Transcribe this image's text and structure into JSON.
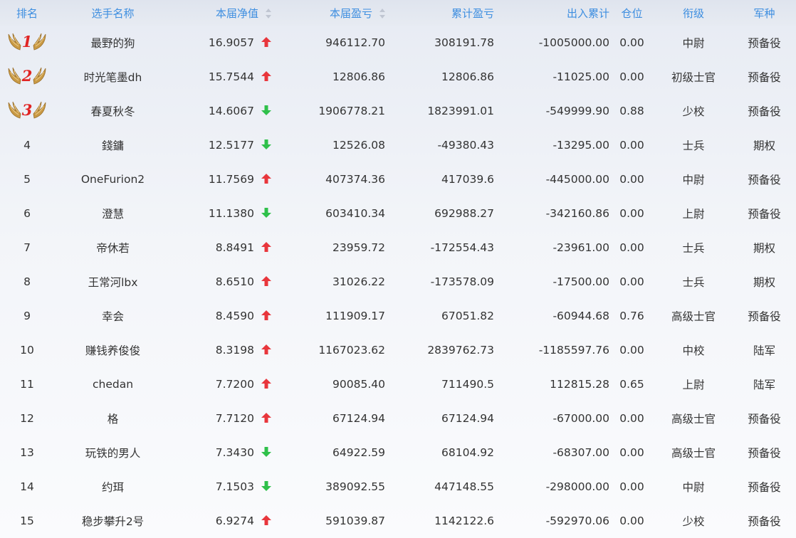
{
  "header": {
    "rank": "排名",
    "name": "选手名称",
    "nav": "本届净值",
    "pnl": "本届盈亏",
    "cum_pnl": "累计盈亏",
    "flow": "出入累计",
    "position": "仓位",
    "title": "衔级",
    "branch": "军种"
  },
  "colors": {
    "header_text": "#3d8ee0",
    "up": "#e8363c",
    "down": "#2fc04a",
    "medal_num": "#e02424",
    "wing": "#c99a45"
  },
  "rows": [
    {
      "rank": "1",
      "name": "最野的狗",
      "nav": "16.9057",
      "trend": "up",
      "pnl": "946112.70",
      "cum_pnl": "308191.78",
      "flow": "-1005000.00",
      "position": "0.00",
      "title": "中尉",
      "branch": "预备役"
    },
    {
      "rank": "2",
      "name": "时光笔墨dh",
      "nav": "15.7544",
      "trend": "up",
      "pnl": "12806.86",
      "cum_pnl": "12806.86",
      "flow": "-11025.00",
      "position": "0.00",
      "title": "初级士官",
      "branch": "预备役"
    },
    {
      "rank": "3",
      "name": "春夏秋冬",
      "nav": "14.6067",
      "trend": "down",
      "pnl": "1906778.21",
      "cum_pnl": "1823991.01",
      "flow": "-549999.90",
      "position": "0.88",
      "title": "少校",
      "branch": "预备役"
    },
    {
      "rank": "4",
      "name": "錢鏞",
      "nav": "12.5177",
      "trend": "down",
      "pnl": "12526.08",
      "cum_pnl": "-49380.43",
      "flow": "-13295.00",
      "position": "0.00",
      "title": "士兵",
      "branch": "期权"
    },
    {
      "rank": "5",
      "name": "OneFurion2",
      "nav": "11.7569",
      "trend": "up",
      "pnl": "407374.36",
      "cum_pnl": "417039.6",
      "flow": "-445000.00",
      "position": "0.00",
      "title": "中尉",
      "branch": "预备役"
    },
    {
      "rank": "6",
      "name": "澄慧",
      "nav": "11.1380",
      "trend": "down",
      "pnl": "603410.34",
      "cum_pnl": "692988.27",
      "flow": "-342160.86",
      "position": "0.00",
      "title": "上尉",
      "branch": "预备役"
    },
    {
      "rank": "7",
      "name": "帝休若",
      "nav": "8.8491",
      "trend": "up",
      "pnl": "23959.72",
      "cum_pnl": "-172554.43",
      "flow": "-23961.00",
      "position": "0.00",
      "title": "士兵",
      "branch": "期权"
    },
    {
      "rank": "8",
      "name": "王常河lbx",
      "nav": "8.6510",
      "trend": "up",
      "pnl": "31026.22",
      "cum_pnl": "-173578.09",
      "flow": "-17500.00",
      "position": "0.00",
      "title": "士兵",
      "branch": "期权"
    },
    {
      "rank": "9",
      "name": "幸会",
      "nav": "8.4590",
      "trend": "up",
      "pnl": "111909.17",
      "cum_pnl": "67051.82",
      "flow": "-60944.68",
      "position": "0.76",
      "title": "高级士官",
      "branch": "预备役"
    },
    {
      "rank": "10",
      "name": "赚钱养俊俊",
      "nav": "8.3198",
      "trend": "up",
      "pnl": "1167023.62",
      "cum_pnl": "2839762.73",
      "flow": "-1185597.76",
      "position": "0.00",
      "title": "中校",
      "branch": "陆军"
    },
    {
      "rank": "11",
      "name": "chedan",
      "nav": "7.7200",
      "trend": "up",
      "pnl": "90085.40",
      "cum_pnl": "711490.5",
      "flow": "112815.28",
      "position": "0.65",
      "title": "上尉",
      "branch": "陆军"
    },
    {
      "rank": "12",
      "name": "格",
      "nav": "7.7120",
      "trend": "up",
      "pnl": "67124.94",
      "cum_pnl": "67124.94",
      "flow": "-67000.00",
      "position": "0.00",
      "title": "高级士官",
      "branch": "预备役"
    },
    {
      "rank": "13",
      "name": "玩铁的男人",
      "nav": "7.3430",
      "trend": "down",
      "pnl": "64922.59",
      "cum_pnl": "68104.92",
      "flow": "-68307.00",
      "position": "0.00",
      "title": "高级士官",
      "branch": "预备役"
    },
    {
      "rank": "14",
      "name": "约珥",
      "nav": "7.1503",
      "trend": "down",
      "pnl": "389092.55",
      "cum_pnl": "447148.55",
      "flow": "-298000.00",
      "position": "0.00",
      "title": "中尉",
      "branch": "预备役"
    },
    {
      "rank": "15",
      "name": "稳步攀升2号",
      "nav": "6.9274",
      "trend": "up",
      "pnl": "591039.87",
      "cum_pnl": "1142122.6",
      "flow": "-592970.06",
      "position": "0.00",
      "title": "少校",
      "branch": "预备役"
    }
  ]
}
